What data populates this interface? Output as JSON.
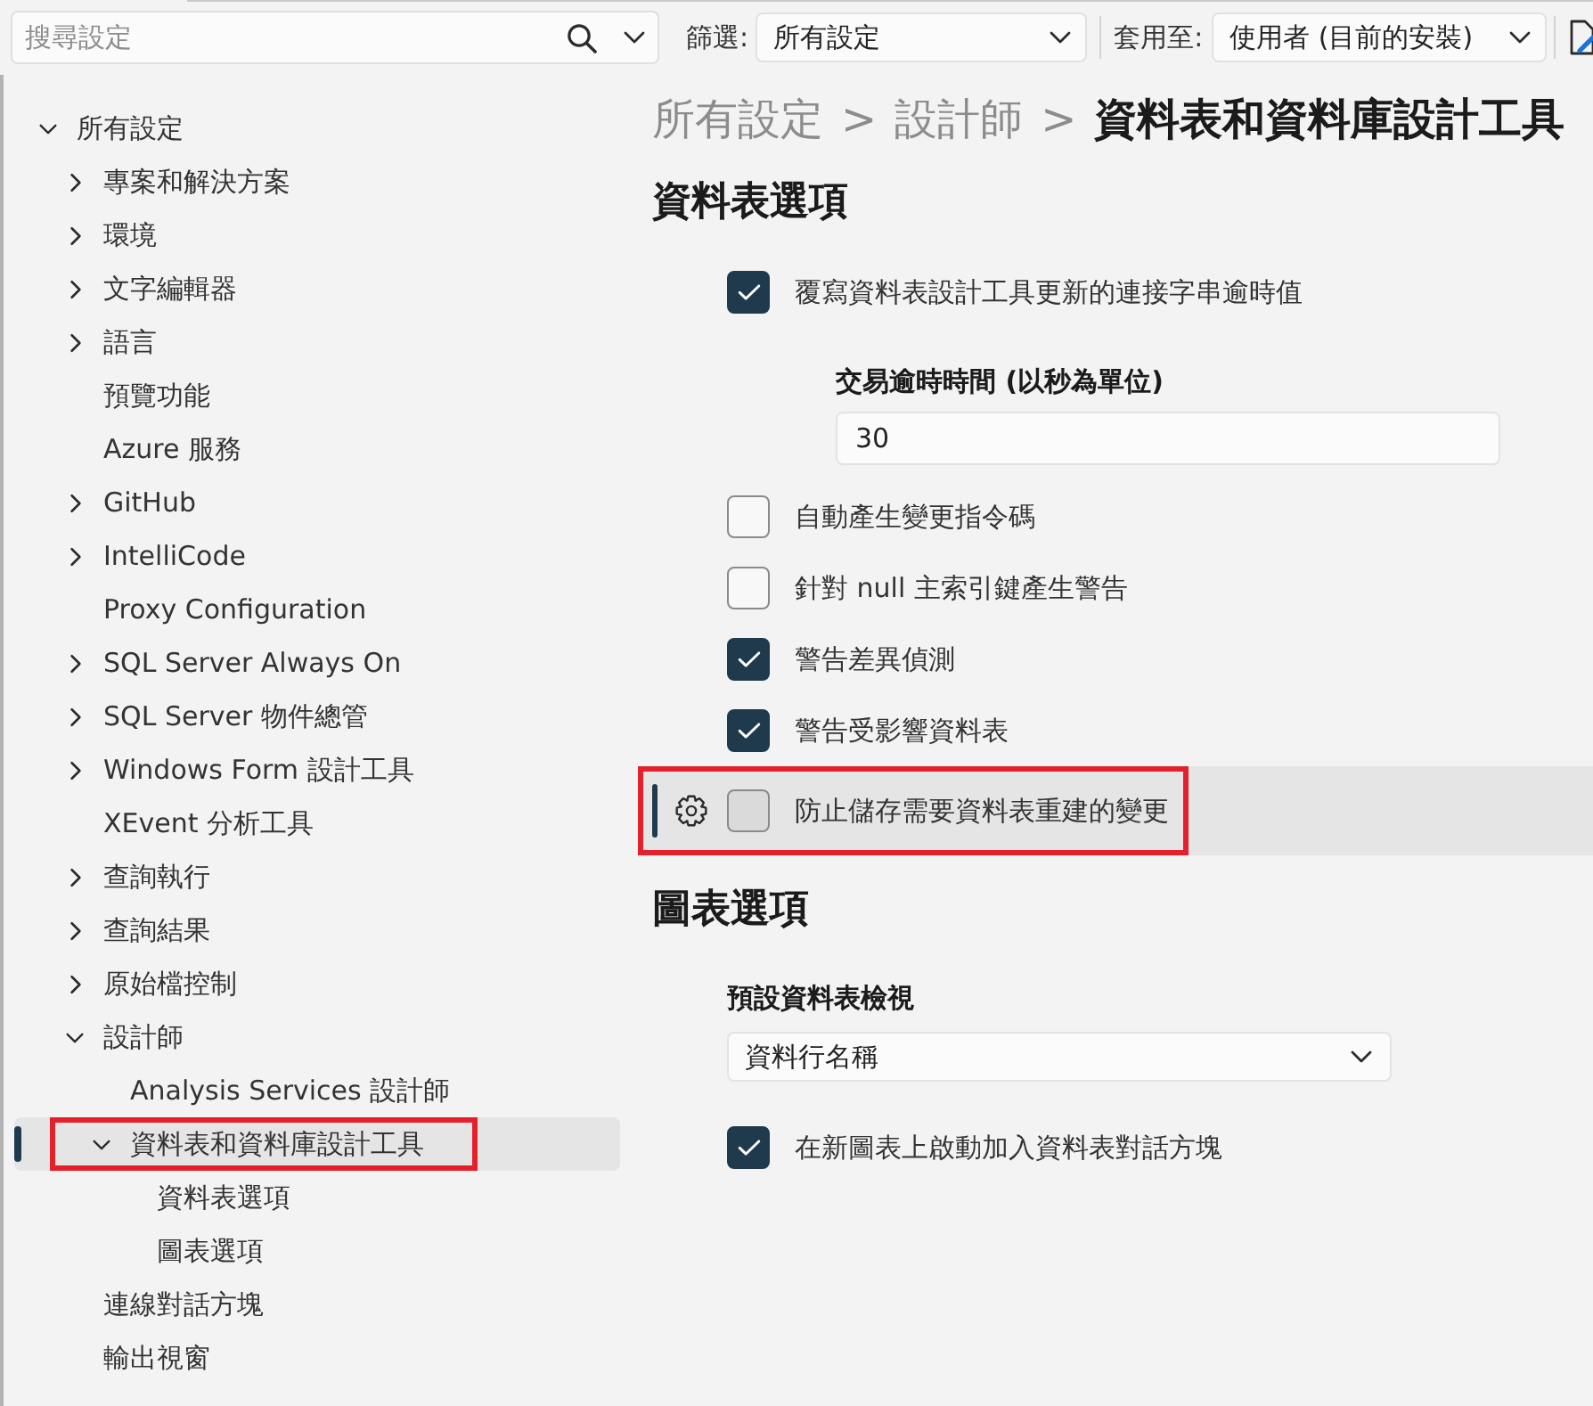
{
  "toolbar": {
    "search": {
      "placeholder": "搜尋設定"
    },
    "filter": {
      "label": "篩選:",
      "value": "所有設定"
    },
    "apply_to": {
      "label": "套用至:",
      "value": "使用者 (目前的安裝)"
    }
  },
  "tree": [
    {
      "label": "所有設定",
      "expanded": true,
      "selected": false,
      "highlighted": false,
      "children": [
        {
          "label": "專案和解決方案",
          "expanded": false,
          "selected": false,
          "highlighted": false
        },
        {
          "label": "環境",
          "expanded": false,
          "selected": false,
          "highlighted": false
        },
        {
          "label": "文字編輯器",
          "expanded": false,
          "selected": false,
          "highlighted": false
        },
        {
          "label": "語言",
          "expanded": false,
          "selected": false,
          "highlighted": false
        },
        {
          "label": "預覽功能",
          "selected": false,
          "highlighted": false
        },
        {
          "label": "Azure 服務",
          "selected": false,
          "highlighted": false
        },
        {
          "label": "GitHub",
          "expanded": false,
          "selected": false,
          "highlighted": false
        },
        {
          "label": "IntelliCode",
          "expanded": false,
          "selected": false,
          "highlighted": false
        },
        {
          "label": "Proxy Configuration",
          "selected": false,
          "highlighted": false
        },
        {
          "label": "SQL Server Always On",
          "expanded": false,
          "selected": false,
          "highlighted": false
        },
        {
          "label": "SQL Server 物件總管",
          "expanded": false,
          "selected": false,
          "highlighted": false
        },
        {
          "label": "Windows Form 設計工具",
          "expanded": false,
          "selected": false,
          "highlighted": false
        },
        {
          "label": "XEvent 分析工具",
          "selected": false,
          "highlighted": false
        },
        {
          "label": "查詢執行",
          "expanded": false,
          "selected": false,
          "highlighted": false
        },
        {
          "label": "查詢結果",
          "expanded": false,
          "selected": false,
          "highlighted": false
        },
        {
          "label": "原始檔控制",
          "expanded": false,
          "selected": false,
          "highlighted": false
        },
        {
          "label": "設計師",
          "expanded": true,
          "selected": false,
          "highlighted": false,
          "children": [
            {
              "label": "Analysis Services 設計師",
              "selected": false,
              "highlighted": false
            },
            {
              "label": "資料表和資料庫設計工具",
              "expanded": true,
              "selected": true,
              "highlighted": true,
              "children": [
                {
                  "label": "資料表選項",
                  "selected": false,
                  "highlighted": false
                },
                {
                  "label": "圖表選項",
                  "selected": false,
                  "highlighted": false
                }
              ]
            }
          ]
        },
        {
          "label": "連線對話方塊",
          "selected": false,
          "highlighted": false
        },
        {
          "label": "輸出視窗",
          "selected": false,
          "highlighted": false
        }
      ]
    }
  ],
  "breadcrumb": {
    "separator": ">",
    "items": [
      "所有設定",
      "設計師",
      "資料表和資料庫設計工具"
    ]
  },
  "sections": [
    {
      "title": "資料表選項",
      "settings": [
        {
          "kind": "checkbox",
          "label": "覆寫資料表設計工具更新的連接字串逾時值",
          "checked": true,
          "focused": false,
          "highlighted": false,
          "children": [
            {
              "kind": "number",
              "label": "交易逾時時間 (以秒為單位)",
              "value": "30",
              "focused": false,
              "highlighted": false
            }
          ]
        },
        {
          "kind": "checkbox",
          "label": "自動產生變更指令碼",
          "checked": false,
          "focused": false,
          "highlighted": false
        },
        {
          "kind": "checkbox",
          "label": "針對 null 主索引鍵產生警告",
          "checked": false,
          "focused": false,
          "highlighted": false
        },
        {
          "kind": "checkbox",
          "label": "警告差異偵測",
          "checked": true,
          "focused": false,
          "highlighted": false
        },
        {
          "kind": "checkbox",
          "label": "警告受影響資料表",
          "checked": true,
          "focused": false,
          "highlighted": false
        },
        {
          "kind": "checkbox",
          "label": "防止儲存需要資料表重建的變更",
          "checked": false,
          "focused": true,
          "highlighted": true
        }
      ]
    },
    {
      "title": "圖表選項",
      "settings": [
        {
          "kind": "dropdown",
          "label": "預設資料表檢視",
          "value": "資料行名稱",
          "focused": false,
          "highlighted": false
        },
        {
          "kind": "checkbox",
          "label": "在新圖表上啟動加入資料表對話方塊",
          "checked": true,
          "focused": false,
          "highlighted": false
        }
      ]
    }
  ]
}
